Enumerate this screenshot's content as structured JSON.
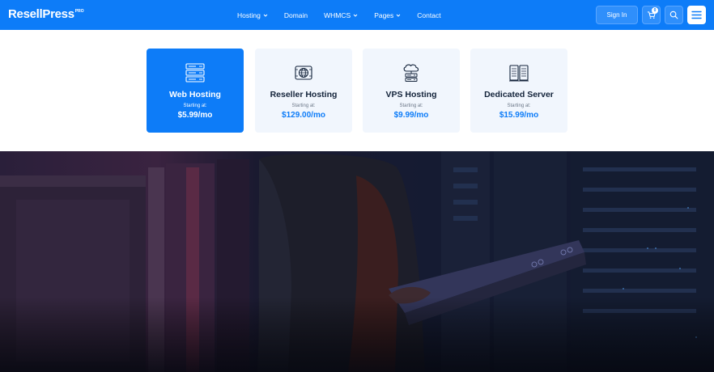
{
  "brand": {
    "name": "ResellPress",
    "suffix": "PRO"
  },
  "nav": {
    "items": [
      {
        "label": "Hosting",
        "has_dropdown": true
      },
      {
        "label": "Domain",
        "has_dropdown": false
      },
      {
        "label": "WHMCS",
        "has_dropdown": true
      },
      {
        "label": "Pages",
        "has_dropdown": true
      },
      {
        "label": "Contact",
        "has_dropdown": false
      }
    ]
  },
  "header_actions": {
    "signin_label": "Sign In",
    "cart_count": "0",
    "cart_icon": "cart-icon",
    "search_icon": "search-icon",
    "menu_icon": "hamburger-menu-icon"
  },
  "cards": [
    {
      "title": "Web Hosting",
      "subtitle": "Starting at:",
      "price": "$5.99/mo",
      "icon": "server-stack-icon",
      "active": true
    },
    {
      "title": "Reseller Hosting",
      "subtitle": "Starting at:",
      "price": "$129.00/mo",
      "icon": "globe-server-icon",
      "active": false
    },
    {
      "title": "VPS Hosting",
      "subtitle": "Starting at:",
      "price": "$9.99/mo",
      "icon": "cloud-server-icon",
      "active": false
    },
    {
      "title": "Dedicated Server",
      "subtitle": "Starting at:",
      "price": "$15.99/mo",
      "icon": "dedicated-server-icon",
      "active": false
    }
  ],
  "colors": {
    "brand_blue": "#0d7cf8",
    "card_bg": "#f1f6fd",
    "title_dark": "#13233a",
    "hero_overlay": "#0f1426"
  }
}
